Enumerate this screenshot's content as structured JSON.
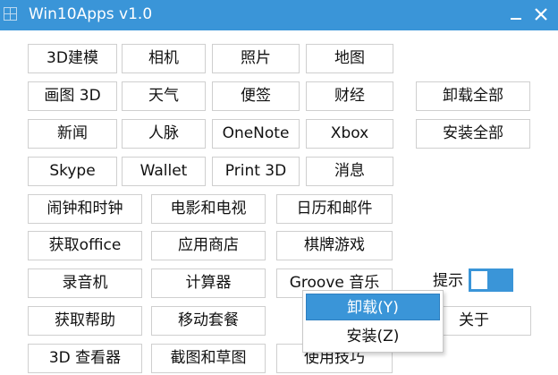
{
  "window": {
    "title": "Win10Apps v1.0",
    "minimize_glyph": "—",
    "close_glyph": "✕"
  },
  "colors": {
    "accent": "#3a95d8",
    "border": "#cfcfcf"
  },
  "icons": {
    "app": "app-icon",
    "minimize": "minimize-icon",
    "close": "close-icon"
  },
  "buttons": {
    "b3d_modeling": "3D建模",
    "camera": "相机",
    "photos": "照片",
    "maps": "地图",
    "paint3d": "画图 3D",
    "weather": "天气",
    "sticky_notes": "便签",
    "finance": "财经",
    "news": "新闻",
    "people": "人脉",
    "onenote": "OneNote",
    "xbox": "Xbox",
    "skype": "Skype",
    "wallet": "Wallet",
    "print3d": "Print 3D",
    "messaging": "消息",
    "alarms": "闹钟和时钟",
    "movies_tv": "电影和电视",
    "calendar_mail": "日历和邮件",
    "get_office": "获取office",
    "store": "应用商店",
    "board_games": "棋牌游戏",
    "voice_recorder": "录音机",
    "calculator": "计算器",
    "groove": "Groove 音乐",
    "get_help": "获取帮助",
    "mobile_plans": "移动套餐",
    "viewer3d": "3D 查看器",
    "snip_sketch": "截图和草图",
    "tips": "使用技巧",
    "uninstall_all": "卸载全部",
    "install_all": "安装全部",
    "about": "关于"
  },
  "hint": {
    "label": "提示",
    "toggle_on": true
  },
  "context_menu": {
    "items": [
      "卸载(Y)",
      "安装(Z)"
    ],
    "highlighted_index": 0
  }
}
